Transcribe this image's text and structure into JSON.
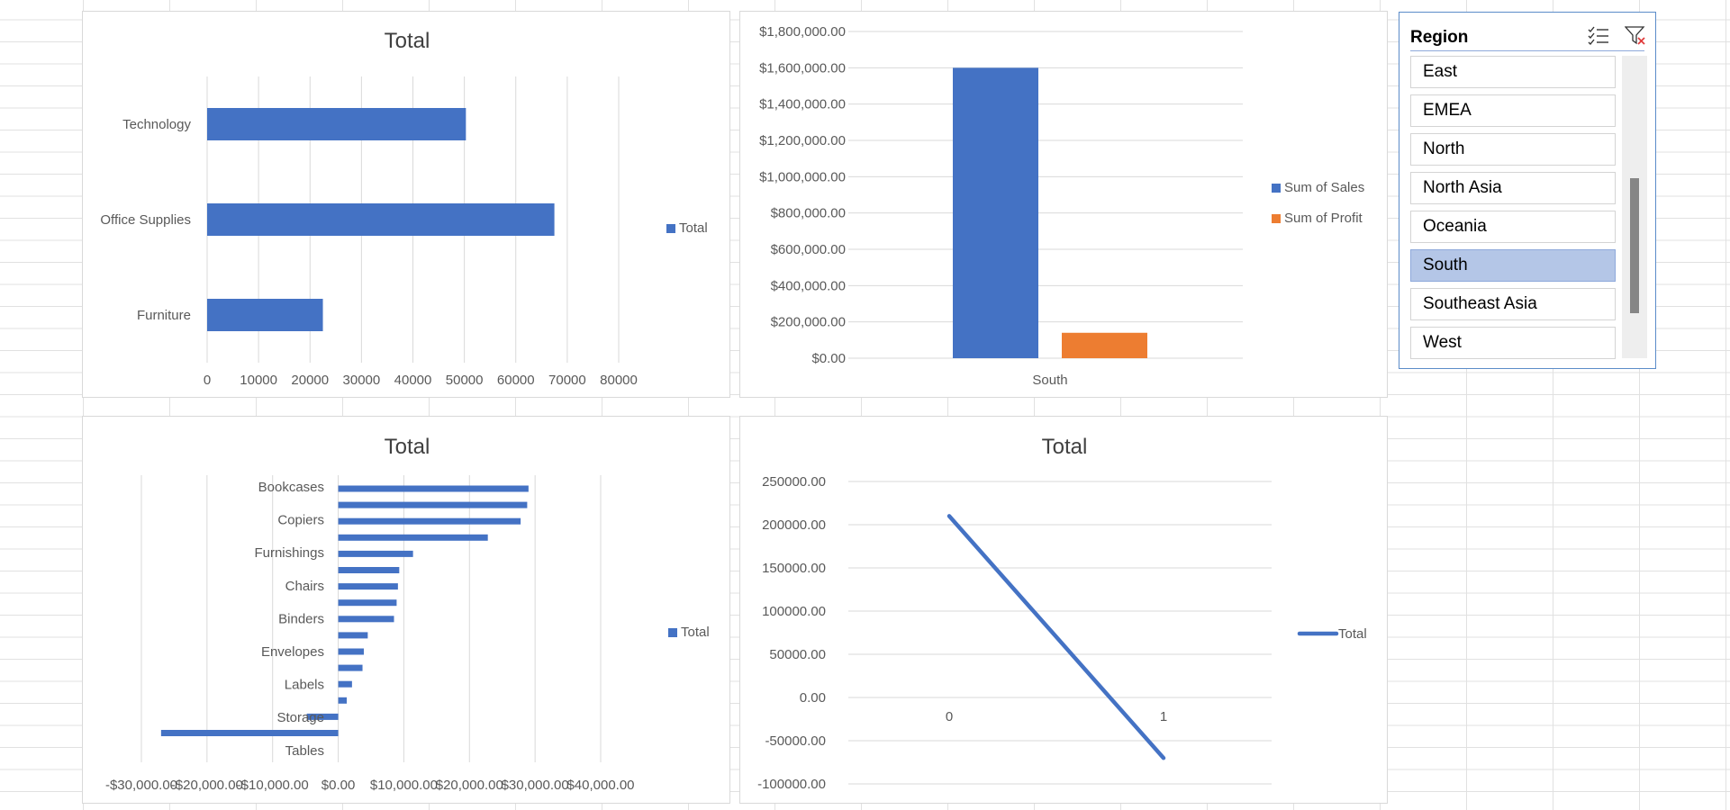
{
  "chart_data": [
    {
      "type": "bar",
      "orientation": "horizontal",
      "title": "Total",
      "categories": [
        "Furniture",
        "Office Supplies",
        "Technology"
      ],
      "series": [
        {
          "name": "Total",
          "values": [
            22500,
            67500,
            50300
          ]
        }
      ],
      "xlim": [
        0,
        80000
      ],
      "xticks": [
        "0",
        "10000",
        "20000",
        "30000",
        "40000",
        "50000",
        "60000",
        "70000",
        "80000"
      ],
      "legend": "right",
      "grid": true,
      "color": "#4472c4"
    },
    {
      "type": "bar",
      "title": "",
      "categories": [
        "South"
      ],
      "series": [
        {
          "name": "Sum of Sales",
          "values": [
            1600000
          ],
          "color": "#4472c4"
        },
        {
          "name": "Sum of Profit",
          "values": [
            140000
          ],
          "color": "#ed7d31"
        }
      ],
      "ylim": [
        0,
        1800000
      ],
      "yticks": [
        "$0.00",
        "$200,000.00",
        "$400,000.00",
        "$600,000.00",
        "$800,000.00",
        "$1,000,000.00",
        "$1,200,000.00",
        "$1,400,000.00",
        "$1,600,000.00",
        "$1,800,000.00"
      ],
      "legend": "right",
      "grid": true
    },
    {
      "type": "bar",
      "orientation": "horizontal",
      "title": "Total",
      "category_labels": [
        "Bookcases",
        "Copiers",
        "Furnishings",
        "Chairs",
        "Binders",
        "Envelopes",
        "Labels",
        "Storage",
        "Tables"
      ],
      "values": [
        29000,
        28800,
        27800,
        22800,
        11400,
        9300,
        9100,
        8900,
        8500,
        4500,
        3900,
        3700,
        2100,
        1300,
        -4800,
        -27000
      ],
      "series": [
        {
          "name": "Total"
        }
      ],
      "xlim": [
        -30000,
        40000
      ],
      "xticks": [
        "-$30,000.00",
        "-$20,000.00",
        "-$10,000.00",
        "$0.00",
        "$10,000.00",
        "$20,000.00",
        "$30,000.00",
        "$40,000.00"
      ],
      "legend": "right",
      "grid": true,
      "color": "#4472c4"
    },
    {
      "type": "line",
      "title": "Total",
      "x": [
        0,
        1
      ],
      "xticks": [
        "0",
        "1"
      ],
      "series": [
        {
          "name": "Total",
          "values": [
            210000,
            -70000
          ]
        }
      ],
      "ylim": [
        -100000,
        250000
      ],
      "yticks": [
        "-100000.00",
        "-50000.00",
        "0.00",
        "50000.00",
        "100000.00",
        "150000.00",
        "200000.00",
        "250000.00"
      ],
      "legend": "right",
      "grid": true,
      "color": "#4472c4"
    }
  ],
  "slicer": {
    "title": "Region",
    "items": [
      "East",
      "EMEA",
      "North",
      "North Asia",
      "Oceania",
      "South",
      "Southeast Asia",
      "West"
    ],
    "selected": "South",
    "multi_select_icon": "multi-select-icon",
    "clear_filter_icon": "clear-filter-icon"
  },
  "colors": {
    "accent": "#4472c4",
    "profit": "#ed7d31",
    "selected_item": "#b4c6e7",
    "gridline": "#d9d9d9",
    "slicer_border": "#5b8cc9"
  }
}
